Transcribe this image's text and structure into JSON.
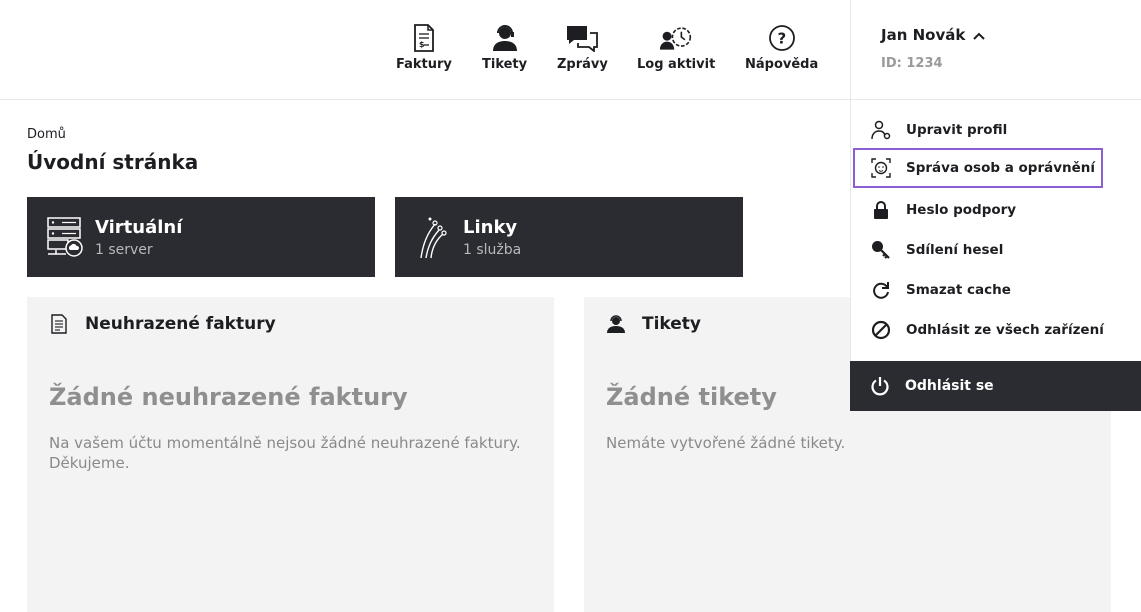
{
  "nav": {
    "items": [
      {
        "label": "Faktury",
        "icon": "invoice-icon"
      },
      {
        "label": "Tikety",
        "icon": "support-agent-icon"
      },
      {
        "label": "Zprávy",
        "icon": "chat-icon"
      },
      {
        "label": "Log aktivit",
        "icon": "activity-log-icon"
      },
      {
        "label": "Nápověda",
        "icon": "help-icon"
      }
    ]
  },
  "user": {
    "name": "Jan Novák",
    "id": "ID: 1234"
  },
  "menu": {
    "items": [
      {
        "label": "Upravit profil",
        "icon": "edit-profile-icon"
      },
      {
        "label": "Správa osob a oprávnění",
        "icon": "face-scan-icon"
      },
      {
        "label": "Heslo podpory",
        "icon": "lock-icon"
      },
      {
        "label": "Sdílení hesel",
        "icon": "key-icon"
      },
      {
        "label": "Smazat cache",
        "icon": "refresh-icon"
      },
      {
        "label": "Odhlásit ze všech zařízení",
        "icon": "block-icon"
      }
    ],
    "logout": "Odhlásit se"
  },
  "breadcrumb": "Domů",
  "page_title": "Úvodní stránka",
  "tiles": [
    {
      "title": "Virtuální",
      "subtitle": "1 server"
    },
    {
      "title": "Linky",
      "subtitle": "1 služba"
    }
  ],
  "panels": {
    "invoices": {
      "title": "Neuhrazené faktury",
      "empty_title": "Žádné neuhrazené faktury",
      "empty_text": "Na vašem účtu momentálně nejsou žádné neuhrazené faktury. Děkujeme."
    },
    "tickets": {
      "title": "Tikety",
      "empty_title": "Žádné tikety",
      "empty_text": "Nemáte vytvořené žádné tikety."
    }
  },
  "colors": {
    "dark": "#2b2c31",
    "panel_bg": "#f3f3f3",
    "highlight": "#8b5fd1",
    "muted_text": "#8f8f8f"
  }
}
